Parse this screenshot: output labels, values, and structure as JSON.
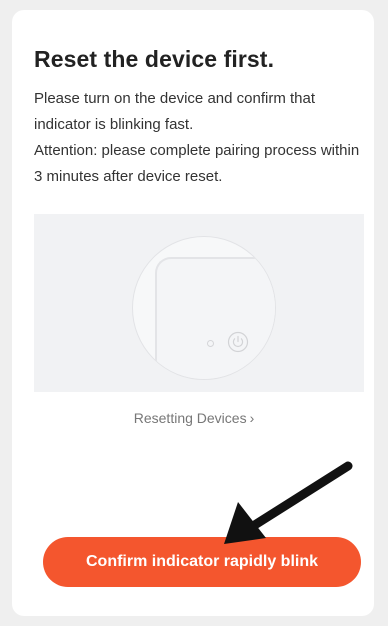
{
  "card": {
    "title": "Reset the device first.",
    "instructions": [
      "Please turn on the device and confirm that indicator is blinking fast.",
      "Attention: please complete pairing process within 3 minutes after device reset."
    ],
    "illustration_icon": "power-icon",
    "link_label": "Resetting Devices",
    "link_chevron": "›",
    "confirm_button_label": "Confirm indicator rapidly blink"
  },
  "colors": {
    "accent": "#f4562e",
    "title": "#222222",
    "body_text": "#333333",
    "link_text": "#777777",
    "illustration_bg": "#f1f2f4",
    "annotation_arrow": "#111111"
  }
}
